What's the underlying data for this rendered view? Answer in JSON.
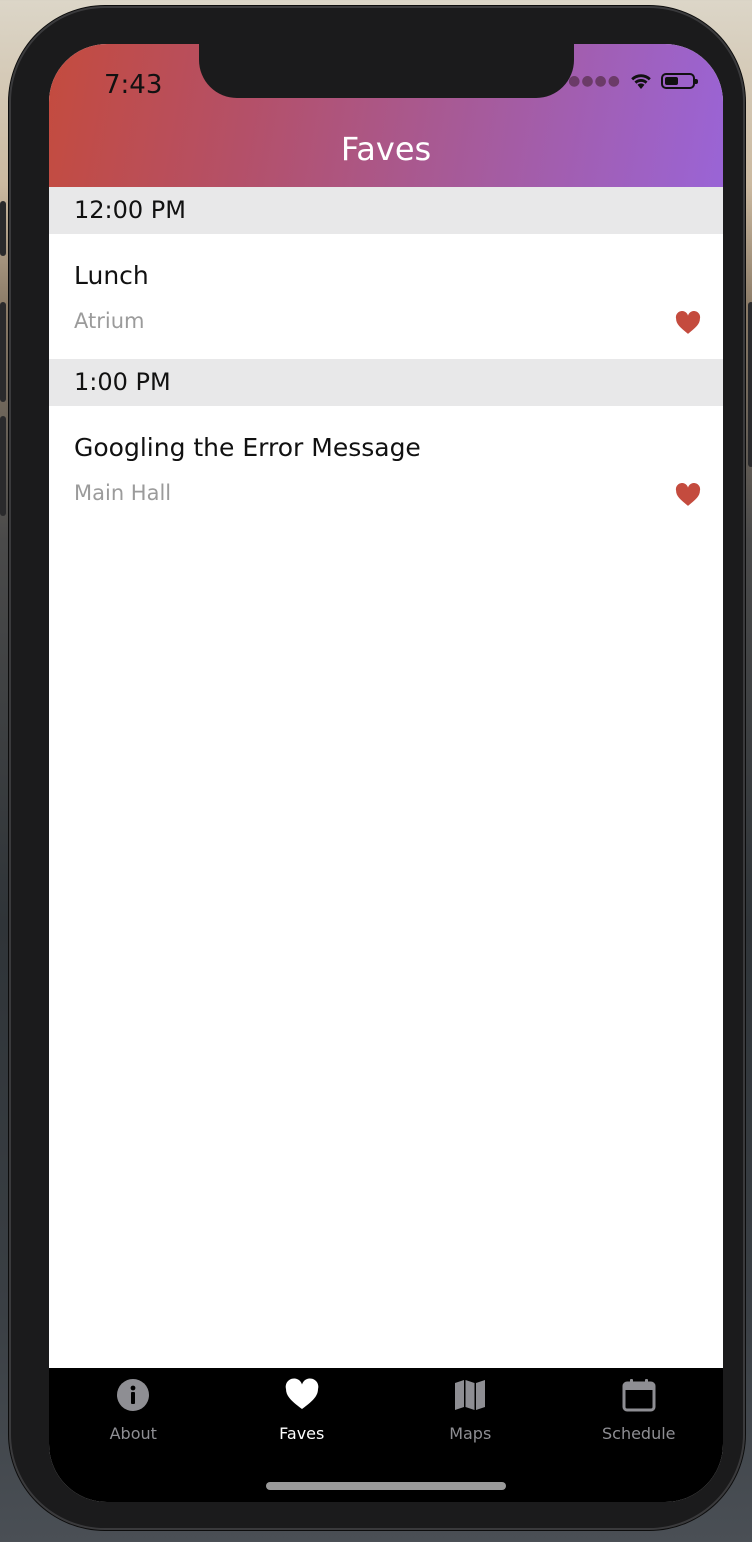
{
  "status_bar": {
    "time": "7:43",
    "signal_icon": "signal-dots-icon",
    "wifi_icon": "wifi-icon",
    "battery_icon": "battery-icon"
  },
  "header": {
    "title": "Faves",
    "gradient_start": "#c44b3e",
    "gradient_end": "#9a64d6"
  },
  "sections": [
    {
      "time": "12:00 PM",
      "sessions": [
        {
          "title": "Lunch",
          "location": "Atrium",
          "favorited": true,
          "icon": "heart-icon"
        }
      ]
    },
    {
      "time": "1:00 PM",
      "sessions": [
        {
          "title": "Googling the Error Message",
          "location": "Main Hall",
          "favorited": true,
          "icon": "heart-icon"
        }
      ]
    }
  ],
  "tabbar": {
    "active_tab": "Faves",
    "tabs": [
      {
        "label": "About",
        "icon": "info-icon"
      },
      {
        "label": "Faves",
        "icon": "heart-icon"
      },
      {
        "label": "Maps",
        "icon": "map-icon"
      },
      {
        "label": "Schedule",
        "icon": "calendar-icon"
      }
    ]
  },
  "colors": {
    "heart": "#c44b3e",
    "section_bg": "#e8e8e9",
    "muted_text": "#9b9b9b",
    "tab_inactive": "#8e8e93",
    "tab_active": "#ffffff"
  }
}
